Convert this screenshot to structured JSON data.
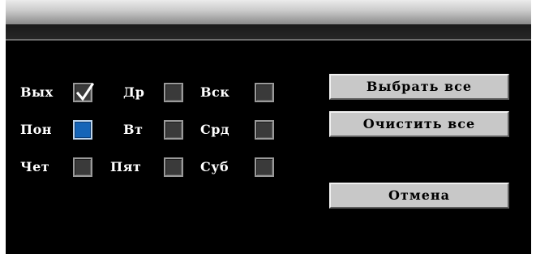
{
  "days": {
    "holiday": {
      "label": "Вых",
      "checked": true
    },
    "dr": {
      "label": "Др",
      "checked": false
    },
    "sun": {
      "label": "Вск",
      "checked": false
    },
    "mon": {
      "label": "Пон",
      "checked": false,
      "focused": true
    },
    "tue": {
      "label": "Вт",
      "checked": false
    },
    "wed": {
      "label": "Срд",
      "checked": false
    },
    "thu": {
      "label": "Чет",
      "checked": false
    },
    "fri": {
      "label": "Пят",
      "checked": false
    },
    "sat": {
      "label": "Суб",
      "checked": false
    }
  },
  "buttons": {
    "select_all": "Выбрать все",
    "clear_all": "Очистить все",
    "cancel": "Отмена"
  },
  "colors": {
    "background": "#000000",
    "focus_accent": "#1565b8",
    "button_face": "#c8c8c8"
  }
}
